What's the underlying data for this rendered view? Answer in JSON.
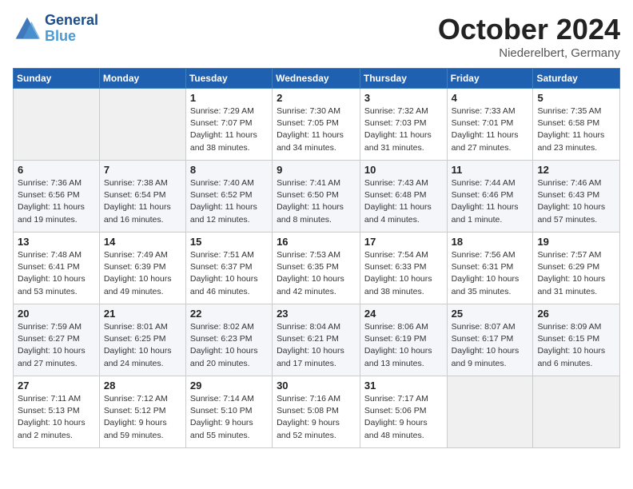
{
  "header": {
    "logo_line1": "General",
    "logo_line2": "Blue",
    "month": "October 2024",
    "location": "Niederelbert, Germany"
  },
  "weekdays": [
    "Sunday",
    "Monday",
    "Tuesday",
    "Wednesday",
    "Thursday",
    "Friday",
    "Saturday"
  ],
  "weeks": [
    [
      {
        "day": "",
        "info": ""
      },
      {
        "day": "",
        "info": ""
      },
      {
        "day": "1",
        "info": "Sunrise: 7:29 AM\nSunset: 7:07 PM\nDaylight: 11 hours and 38 minutes."
      },
      {
        "day": "2",
        "info": "Sunrise: 7:30 AM\nSunset: 7:05 PM\nDaylight: 11 hours and 34 minutes."
      },
      {
        "day": "3",
        "info": "Sunrise: 7:32 AM\nSunset: 7:03 PM\nDaylight: 11 hours and 31 minutes."
      },
      {
        "day": "4",
        "info": "Sunrise: 7:33 AM\nSunset: 7:01 PM\nDaylight: 11 hours and 27 minutes."
      },
      {
        "day": "5",
        "info": "Sunrise: 7:35 AM\nSunset: 6:58 PM\nDaylight: 11 hours and 23 minutes."
      }
    ],
    [
      {
        "day": "6",
        "info": "Sunrise: 7:36 AM\nSunset: 6:56 PM\nDaylight: 11 hours and 19 minutes."
      },
      {
        "day": "7",
        "info": "Sunrise: 7:38 AM\nSunset: 6:54 PM\nDaylight: 11 hours and 16 minutes."
      },
      {
        "day": "8",
        "info": "Sunrise: 7:40 AM\nSunset: 6:52 PM\nDaylight: 11 hours and 12 minutes."
      },
      {
        "day": "9",
        "info": "Sunrise: 7:41 AM\nSunset: 6:50 PM\nDaylight: 11 hours and 8 minutes."
      },
      {
        "day": "10",
        "info": "Sunrise: 7:43 AM\nSunset: 6:48 PM\nDaylight: 11 hours and 4 minutes."
      },
      {
        "day": "11",
        "info": "Sunrise: 7:44 AM\nSunset: 6:46 PM\nDaylight: 11 hours and 1 minute."
      },
      {
        "day": "12",
        "info": "Sunrise: 7:46 AM\nSunset: 6:43 PM\nDaylight: 10 hours and 57 minutes."
      }
    ],
    [
      {
        "day": "13",
        "info": "Sunrise: 7:48 AM\nSunset: 6:41 PM\nDaylight: 10 hours and 53 minutes."
      },
      {
        "day": "14",
        "info": "Sunrise: 7:49 AM\nSunset: 6:39 PM\nDaylight: 10 hours and 49 minutes."
      },
      {
        "day": "15",
        "info": "Sunrise: 7:51 AM\nSunset: 6:37 PM\nDaylight: 10 hours and 46 minutes."
      },
      {
        "day": "16",
        "info": "Sunrise: 7:53 AM\nSunset: 6:35 PM\nDaylight: 10 hours and 42 minutes."
      },
      {
        "day": "17",
        "info": "Sunrise: 7:54 AM\nSunset: 6:33 PM\nDaylight: 10 hours and 38 minutes."
      },
      {
        "day": "18",
        "info": "Sunrise: 7:56 AM\nSunset: 6:31 PM\nDaylight: 10 hours and 35 minutes."
      },
      {
        "day": "19",
        "info": "Sunrise: 7:57 AM\nSunset: 6:29 PM\nDaylight: 10 hours and 31 minutes."
      }
    ],
    [
      {
        "day": "20",
        "info": "Sunrise: 7:59 AM\nSunset: 6:27 PM\nDaylight: 10 hours and 27 minutes."
      },
      {
        "day": "21",
        "info": "Sunrise: 8:01 AM\nSunset: 6:25 PM\nDaylight: 10 hours and 24 minutes."
      },
      {
        "day": "22",
        "info": "Sunrise: 8:02 AM\nSunset: 6:23 PM\nDaylight: 10 hours and 20 minutes."
      },
      {
        "day": "23",
        "info": "Sunrise: 8:04 AM\nSunset: 6:21 PM\nDaylight: 10 hours and 17 minutes."
      },
      {
        "day": "24",
        "info": "Sunrise: 8:06 AM\nSunset: 6:19 PM\nDaylight: 10 hours and 13 minutes."
      },
      {
        "day": "25",
        "info": "Sunrise: 8:07 AM\nSunset: 6:17 PM\nDaylight: 10 hours and 9 minutes."
      },
      {
        "day": "26",
        "info": "Sunrise: 8:09 AM\nSunset: 6:15 PM\nDaylight: 10 hours and 6 minutes."
      }
    ],
    [
      {
        "day": "27",
        "info": "Sunrise: 7:11 AM\nSunset: 5:13 PM\nDaylight: 10 hours and 2 minutes."
      },
      {
        "day": "28",
        "info": "Sunrise: 7:12 AM\nSunset: 5:12 PM\nDaylight: 9 hours and 59 minutes."
      },
      {
        "day": "29",
        "info": "Sunrise: 7:14 AM\nSunset: 5:10 PM\nDaylight: 9 hours and 55 minutes."
      },
      {
        "day": "30",
        "info": "Sunrise: 7:16 AM\nSunset: 5:08 PM\nDaylight: 9 hours and 52 minutes."
      },
      {
        "day": "31",
        "info": "Sunrise: 7:17 AM\nSunset: 5:06 PM\nDaylight: 9 hours and 48 minutes."
      },
      {
        "day": "",
        "info": ""
      },
      {
        "day": "",
        "info": ""
      }
    ]
  ]
}
